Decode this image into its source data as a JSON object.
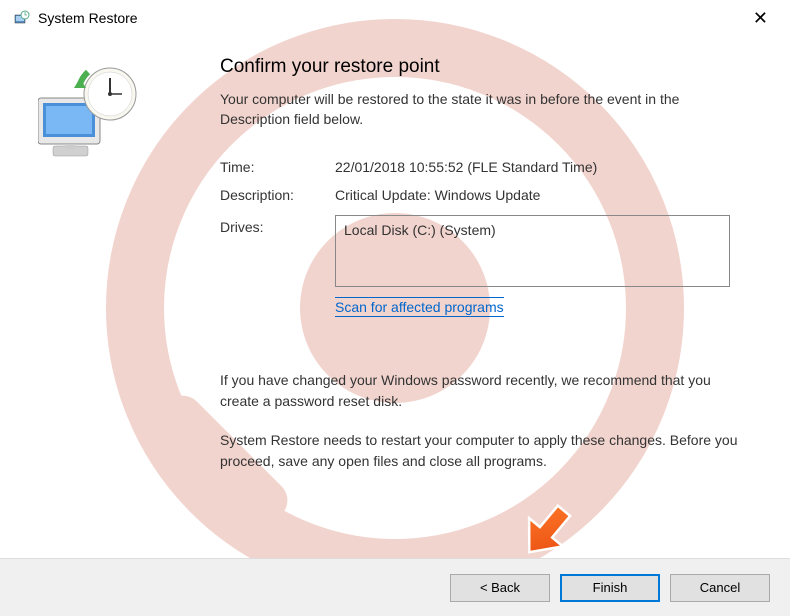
{
  "titlebar": {
    "title": "System Restore"
  },
  "heading": "Confirm your restore point",
  "subheading": "Your computer will be restored to the state it was in before the event in the Description field below.",
  "fields": {
    "time_label": "Time:",
    "time_value": "22/01/2018 10:55:52 (FLE Standard Time)",
    "description_label": "Description:",
    "description_value": "Critical Update: Windows Update",
    "drives_label": "Drives:",
    "drives_value": "Local Disk (C:) (System)"
  },
  "scan_link": "Scan for affected programs",
  "info1": "If you have changed your Windows password recently, we recommend that you create a password reset disk.",
  "info2": "System Restore needs to restart your computer to apply these changes. Before you proceed, save any open files and close all programs.",
  "buttons": {
    "back": "< Back",
    "finish": "Finish",
    "cancel": "Cancel"
  }
}
